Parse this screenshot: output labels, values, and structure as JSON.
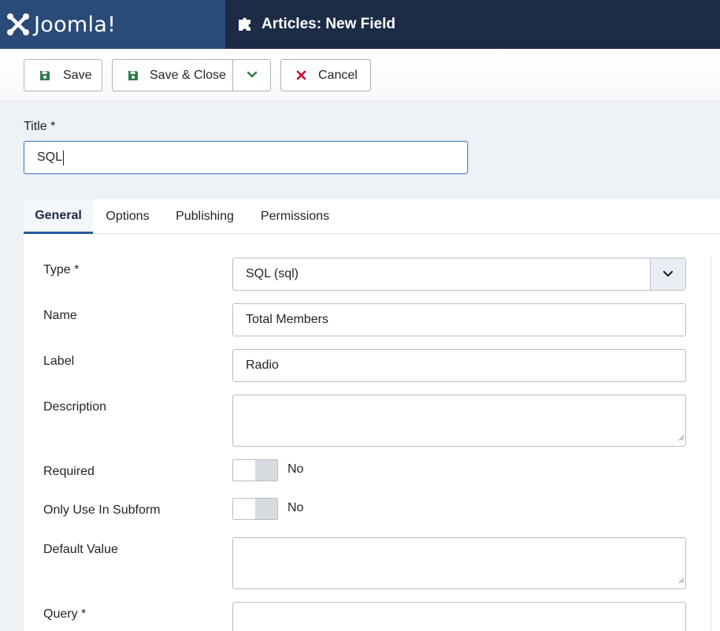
{
  "brand": {
    "logo_text": "Joomla!"
  },
  "header": {
    "page_title": "Articles: New Field"
  },
  "toolbar": {
    "save_label": "Save",
    "save_close_label": "Save & Close",
    "cancel_label": "Cancel"
  },
  "title_field": {
    "label": "Title *",
    "value": "SQL"
  },
  "tabs": [
    {
      "label": "General",
      "active": true
    },
    {
      "label": "Options",
      "active": false
    },
    {
      "label": "Publishing",
      "active": false
    },
    {
      "label": "Permissions",
      "active": false
    }
  ],
  "form": {
    "type": {
      "label": "Type *",
      "value": "SQL (sql)"
    },
    "name": {
      "label": "Name",
      "value": "Total Members"
    },
    "field_label": {
      "label": "Label",
      "value": "Radio"
    },
    "description": {
      "label": "Description",
      "value": ""
    },
    "required": {
      "label": "Required",
      "state": "No"
    },
    "only_subform": {
      "label": "Only Use In Subform",
      "state": "No"
    },
    "default_value": {
      "label": "Default Value",
      "value": ""
    },
    "query": {
      "label": "Query *",
      "value": ""
    }
  },
  "colors": {
    "header_bg": "#1c2b46",
    "logo_bg": "#2a4a78",
    "save_icon": "#2f7a4a",
    "cancel_icon": "#c8102e",
    "focus_border": "#4a7fc8"
  },
  "icons": {
    "logo": "joomla-logo-icon",
    "page": "puzzle-piece-icon",
    "save": "floppy-disk-icon",
    "dropdown": "chevron-down-icon",
    "cancel": "close-x-icon"
  }
}
